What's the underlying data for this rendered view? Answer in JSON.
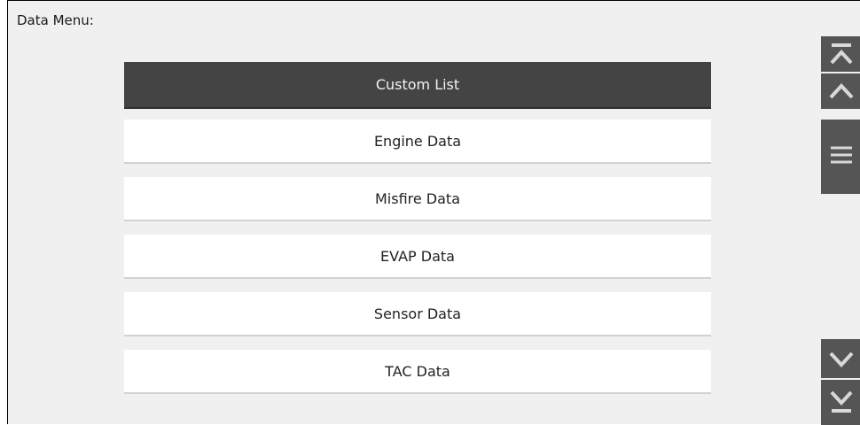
{
  "menu": {
    "title": "Data Menu:",
    "items": [
      {
        "label": "Custom List",
        "selected": true
      },
      {
        "label": "Engine Data",
        "selected": false
      },
      {
        "label": "Misfire Data",
        "selected": false
      },
      {
        "label": "EVAP Data",
        "selected": false
      },
      {
        "label": "Sensor Data",
        "selected": false
      },
      {
        "label": "TAC Data",
        "selected": false
      }
    ]
  },
  "scrollbar": {
    "buttons": [
      "scroll-to-top",
      "scroll-up",
      "scroll-thumb",
      "scroll-down",
      "scroll-to-bottom"
    ]
  },
  "colors": {
    "selected_bg": "#444444",
    "item_bg": "#ffffff",
    "panel_bg": "#f0f0f0",
    "scroll_button": "#555555"
  }
}
